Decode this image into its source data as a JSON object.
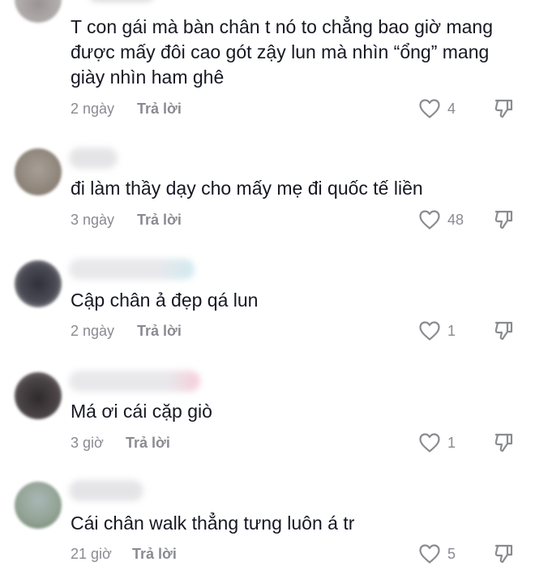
{
  "comments": [
    {
      "text": "T con gái mà bàn chân t nó to chẳng bao giờ mang được mấy đôi cao gót zậy lun mà nhìn “ổng” mang giày nhìn ham ghê",
      "time": "2 ngày",
      "reply": "Trả lời",
      "likes": "4"
    },
    {
      "text": "đi làm thầy dạy cho mấy mẹ đi quốc tế liền",
      "time": "3 ngày",
      "reply": "Trả lời",
      "likes": "48"
    },
    {
      "text": "Cập chân ả đẹp qá lun",
      "time": "2 ngày",
      "reply": "Trả lời",
      "likes": "1"
    },
    {
      "text": "Má ơi cái cặp giò",
      "time": "3 giờ",
      "reply": "Trả lời",
      "likes": "1"
    },
    {
      "text": "Cái chân walk thẳng tưng luôn á tr",
      "time": "21 giờ",
      "reply": "Trả lời",
      "likes": "5"
    }
  ],
  "icons": {
    "like": "heart-outline-icon",
    "dislike": "thumbs-down-outline-icon"
  },
  "colors": {
    "text": "#161823",
    "meta": "#8a8b91"
  }
}
